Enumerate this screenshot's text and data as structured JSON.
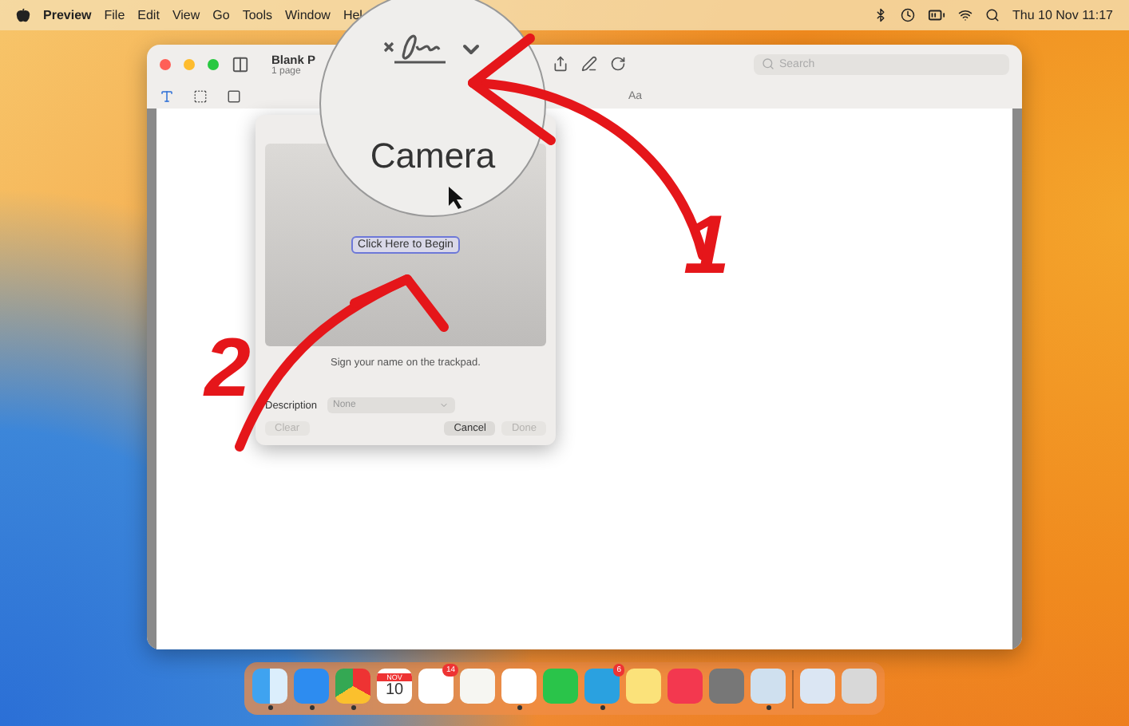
{
  "menu_bar": {
    "app": "Preview",
    "menus": [
      "File",
      "Edit",
      "View",
      "Go",
      "Tools",
      "Window",
      "Hel"
    ],
    "clock": "Thu 10 Nov 11:17"
  },
  "window": {
    "title": "Blank P",
    "subtitle": "1 page",
    "search": {
      "placeholder": "Search"
    },
    "font_button": "Aa"
  },
  "magnifier": {
    "label": "Camera"
  },
  "signature_panel": {
    "begin_button": "Click Here to Begin",
    "hint": "Sign your name on the trackpad.",
    "description_label": "Description",
    "description_value": "None",
    "buttons": [
      {
        "label": "Clear",
        "disabled": true
      },
      {
        "label": "Cancel",
        "disabled": false
      },
      {
        "label": "Done",
        "disabled": true
      }
    ]
  },
  "annotations": [
    "1",
    "2"
  ],
  "dock": {
    "apps": [
      {
        "kind": "finder",
        "running": true
      },
      {
        "kind": "safari",
        "running": true
      },
      {
        "kind": "chrome",
        "running": true
      },
      {
        "kind": "calendar",
        "running": false,
        "month": "NOV",
        "day": "10"
      },
      {
        "kind": "reminders",
        "running": false,
        "badge": "14"
      },
      {
        "kind": "textedit",
        "running": false
      },
      {
        "kind": "slack",
        "running": true
      },
      {
        "kind": "whatsapp",
        "running": false
      },
      {
        "kind": "telegram",
        "running": true,
        "badge": "6"
      },
      {
        "kind": "notes",
        "running": false
      },
      {
        "kind": "music",
        "running": false
      },
      {
        "kind": "settings",
        "running": false
      },
      {
        "kind": "preview",
        "running": true
      },
      {
        "kind": "separator"
      },
      {
        "kind": "downloads",
        "running": false
      },
      {
        "kind": "trash",
        "running": false
      }
    ]
  }
}
